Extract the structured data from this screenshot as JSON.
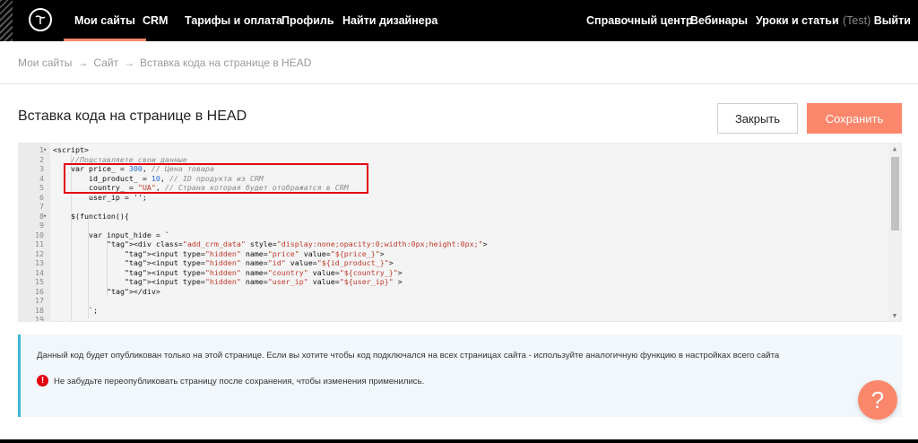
{
  "nav": {
    "left": [
      "Мои сайты",
      "CRM",
      "Тарифы и оплата",
      "Профиль",
      "Найти дизайнера"
    ],
    "right": [
      "Справочный центр",
      "Вебинары",
      "Уроки и статьи"
    ],
    "user_prefix": "(Test)",
    "logout": "Выйти"
  },
  "breadcrumb": {
    "items": [
      "Мои сайты",
      "Сайт",
      "Вставка кода на странице в HEAD"
    ],
    "sep": "→"
  },
  "page": {
    "title": "Вставка кода на странице в HEAD",
    "close_label": "Закрыть",
    "save_label": "Сохранить"
  },
  "editor": {
    "line_numbers": [
      "1",
      "2",
      "3",
      "4",
      "5",
      "6",
      "7",
      "8",
      "9",
      "10",
      "11",
      "12",
      "13",
      "14",
      "15",
      "16",
      "17",
      "18",
      "19"
    ],
    "lines": [
      "<script>",
      "    //Подставляете свои данные",
      "    var price_ = 300, // Цена товара",
      "        id_product_ = 10, // ID продукта из CRM",
      "        country_ = \"UA\", // Страна которая будет отображатся в CRM",
      "        user_ip = '';",
      "",
      "    $(function(){",
      "",
      "        var input_hide = `",
      "            <div class=\"add_crm_data\" style=\"display:none;opacity:0;width:0px;height:0px;\">",
      "                <input type=\"hidden\" name=\"price\" value=\"${price_}\">",
      "                <input type=\"hidden\" name=\"id\" value=\"${id_product_}\">",
      "                <input type=\"hidden\" name=\"country\" value=\"${country_}\">",
      "                <input type=\"hidden\" name=\"user_ip\" value=\"${user_ip}\" >",
      "            </div>",
      "",
      "        `;",
      ""
    ]
  },
  "info": {
    "message": "Данный код будет опубликован только на этой странице. Если вы хотите чтобы код подключался на всех страницах сайта - используйте аналогичную функцию в настройках всего сайта",
    "warning": "Не забудьте переопубликовать страницу после сохранения, чтобы изменения применились.",
    "warning_icon": "!"
  },
  "help": {
    "label": "?"
  },
  "colors": {
    "accent": "#fa876b",
    "highlight": "#e3000f",
    "info_border": "#3fb5d8"
  }
}
